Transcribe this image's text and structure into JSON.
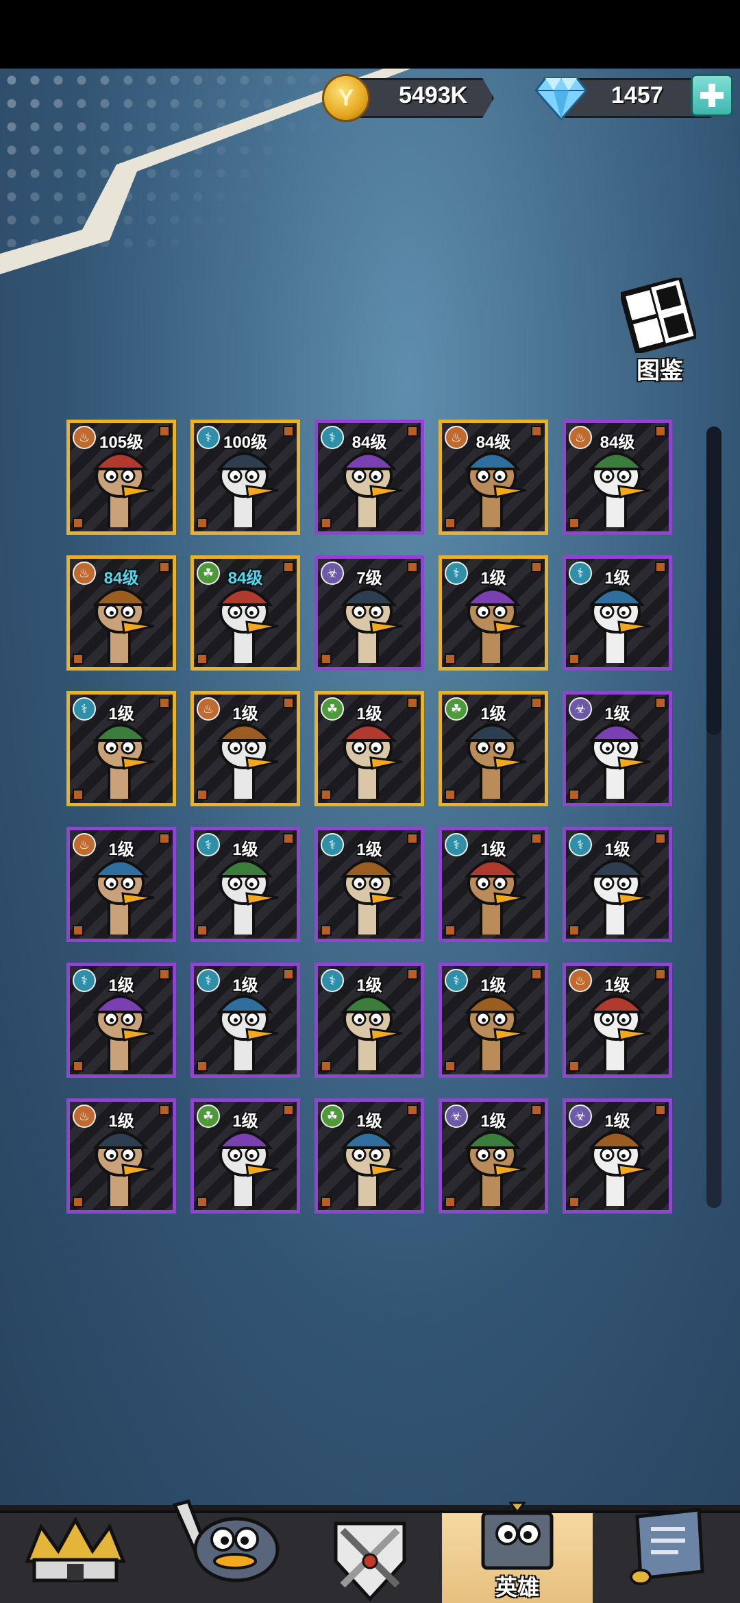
{
  "currency": {
    "coins": "5493K",
    "coin_symbol": "Y",
    "gems": "1457"
  },
  "codex": {
    "label": "图鉴"
  },
  "heroes": [
    {
      "level": "105级",
      "element": "fire",
      "frame": "gold",
      "level_color": "white"
    },
    {
      "level": "100级",
      "element": "water",
      "frame": "gold",
      "level_color": "white"
    },
    {
      "level": "84级",
      "element": "water",
      "frame": "purple",
      "level_color": "white"
    },
    {
      "level": "84级",
      "element": "fire",
      "frame": "gold",
      "level_color": "white"
    },
    {
      "level": "84级",
      "element": "fire",
      "frame": "purple",
      "level_color": "white"
    },
    {
      "level": "84级",
      "element": "fire",
      "frame": "gold",
      "level_color": "cyan"
    },
    {
      "level": "84级",
      "element": "nature",
      "frame": "gold",
      "level_color": "cyan"
    },
    {
      "level": "7级",
      "element": "bio",
      "frame": "purple",
      "level_color": "white"
    },
    {
      "level": "1级",
      "element": "water",
      "frame": "gold",
      "level_color": "white"
    },
    {
      "level": "1级",
      "element": "water",
      "frame": "purple",
      "level_color": "white"
    },
    {
      "level": "1级",
      "element": "water",
      "frame": "gold",
      "level_color": "white"
    },
    {
      "level": "1级",
      "element": "fire",
      "frame": "gold",
      "level_color": "white"
    },
    {
      "level": "1级",
      "element": "nature",
      "frame": "gold",
      "level_color": "white"
    },
    {
      "level": "1级",
      "element": "nature",
      "frame": "gold",
      "level_color": "white"
    },
    {
      "level": "1级",
      "element": "bio",
      "frame": "purple",
      "level_color": "white"
    },
    {
      "level": "1级",
      "element": "fire",
      "frame": "purple",
      "level_color": "white"
    },
    {
      "level": "1级",
      "element": "water",
      "frame": "purple",
      "level_color": "white"
    },
    {
      "level": "1级",
      "element": "water",
      "frame": "purple",
      "level_color": "white"
    },
    {
      "level": "1级",
      "element": "water",
      "frame": "purple",
      "level_color": "white"
    },
    {
      "level": "1级",
      "element": "water",
      "frame": "purple",
      "level_color": "white"
    },
    {
      "level": "1级",
      "element": "water",
      "frame": "purple",
      "level_color": "white"
    },
    {
      "level": "1级",
      "element": "water",
      "frame": "purple",
      "level_color": "white"
    },
    {
      "level": "1级",
      "element": "water",
      "frame": "purple",
      "level_color": "white"
    },
    {
      "level": "1级",
      "element": "water",
      "frame": "purple",
      "level_color": "white"
    },
    {
      "level": "1级",
      "element": "fire",
      "frame": "purple",
      "level_color": "white"
    },
    {
      "level": "1级",
      "element": "fire",
      "frame": "purple",
      "level_color": "white"
    },
    {
      "level": "1级",
      "element": "nature",
      "frame": "purple",
      "level_color": "white"
    },
    {
      "level": "1级",
      "element": "nature",
      "frame": "purple",
      "level_color": "white"
    },
    {
      "level": "1级",
      "element": "bio",
      "frame": "purple",
      "level_color": "white"
    },
    {
      "level": "1级",
      "element": "bio",
      "frame": "purple",
      "level_color": "white"
    }
  ],
  "element_colors": {
    "fire": "#c06a2f",
    "water": "#2f8fa8",
    "nature": "#4e9a3b",
    "bio": "#6c5aa8"
  },
  "bottom_nav": {
    "tabs": [
      {
        "icon": "crown-castle-icon",
        "label": ""
      },
      {
        "icon": "duck-sword-icon",
        "label": ""
      },
      {
        "icon": "crossed-swords-shield-icon",
        "label": ""
      },
      {
        "icon": "duck-book-icon",
        "label": "英雄",
        "active": true
      },
      {
        "icon": "scroll-map-icon",
        "label": ""
      }
    ]
  }
}
